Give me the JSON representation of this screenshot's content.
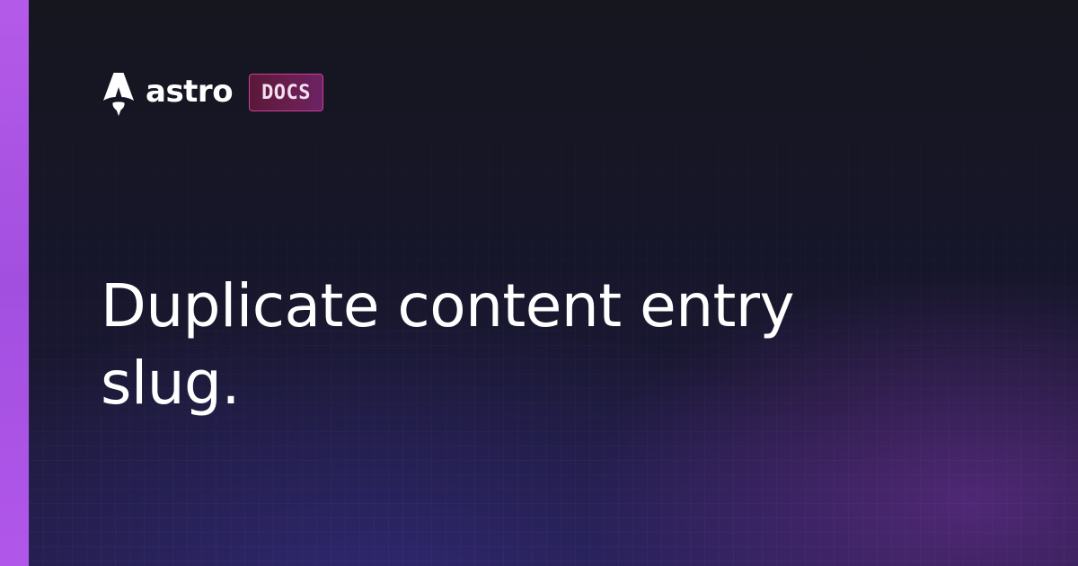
{
  "brand": {
    "logo_icon": "astro-rocket-icon",
    "wordmark": "astro",
    "badge": "DOCS"
  },
  "page": {
    "title": "Duplicate content entry slug."
  },
  "colors": {
    "accent_bar": "#a855f7",
    "background": "#13151d",
    "badge_border": "#c9409a",
    "badge_fill": "#5a1838",
    "title_text": "#ffffff"
  }
}
